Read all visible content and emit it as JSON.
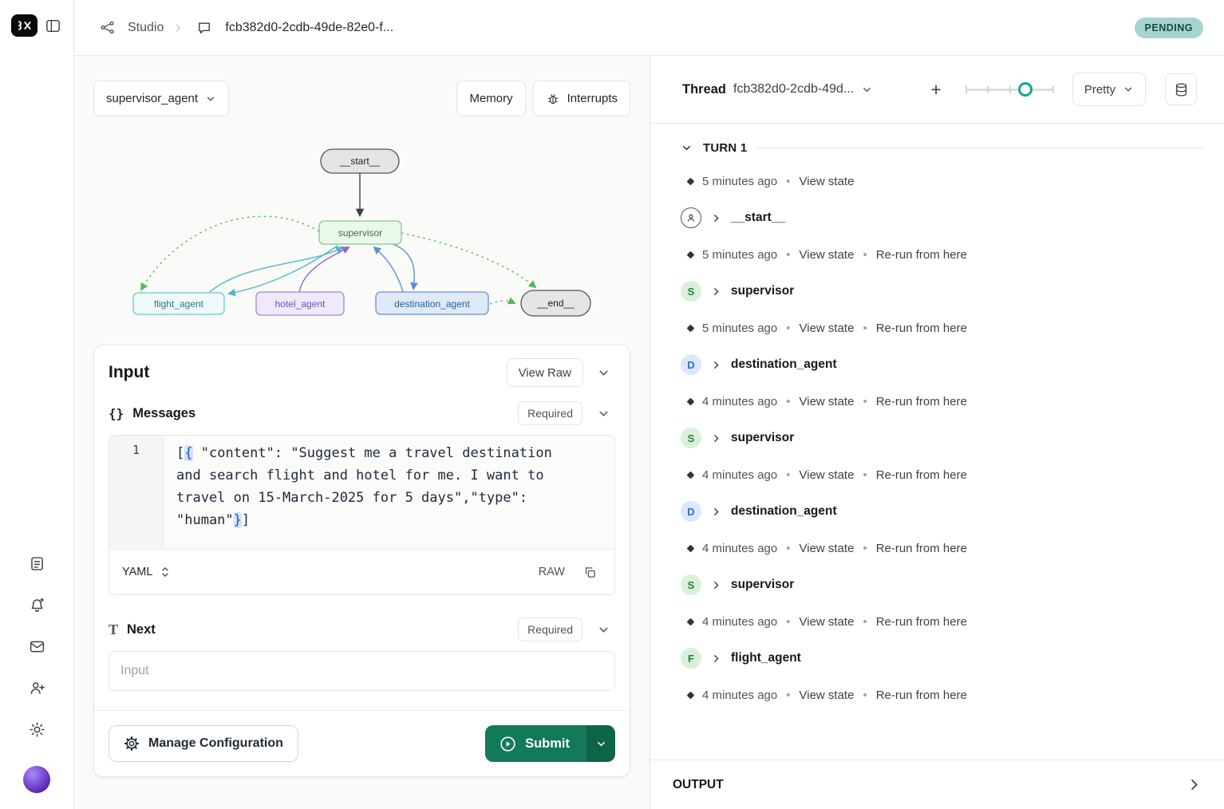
{
  "colors": {
    "accent_green": "#12795a",
    "accent_green_dark": "#0d6447",
    "pending_bg": "#a7d4cf",
    "pending_text": "#1a4742",
    "slider_accent": "#1aa396",
    "badge_green_bg": "#d8f1da",
    "badge_green_text": "#2c8040",
    "badge_blue_bg": "#d9e8fa",
    "badge_blue_text": "#2f6fce"
  },
  "header": {
    "app": "Studio",
    "thread_id": "fcb382d0-2cdb-49de-82e0-f...",
    "status": "PENDING"
  },
  "graph_panel": {
    "agent_selector": "supervisor_agent",
    "memory_button": "Memory",
    "interrupts_button": "Interrupts",
    "nodes": {
      "start": "__start__",
      "supervisor": "supervisor",
      "flight_agent": "flight_agent",
      "hotel_agent": "hotel_agent",
      "destination_agent": "destination_agent",
      "end": "__end__"
    }
  },
  "input_card": {
    "title": "Input",
    "view_raw_button": "View Raw",
    "messages": {
      "icon": "{}",
      "label": "Messages",
      "required_badge": "Required"
    },
    "editor": {
      "line_number": "1",
      "language": "YAML",
      "raw_label": "RAW",
      "segments": [
        {
          "text": "[",
          "cls": "tok"
        },
        {
          "text": "{",
          "cls": "tok-hl"
        },
        {
          "text": " \"content\": \"Suggest me a travel destination and search flight and hotel for me. I want to travel on 15-March-2025 for 5 days\",\"type\": \"human\"",
          "cls": "tok"
        },
        {
          "text": "}",
          "cls": "tok-hl"
        },
        {
          "text": "]",
          "cls": "tok"
        }
      ]
    },
    "next": {
      "icon": "T",
      "label": "Next",
      "required_badge": "Required",
      "placeholder": "Input"
    },
    "manage_config_button": "Manage Configuration",
    "submit_button": "Submit"
  },
  "thread_panel": {
    "thread_label": "Thread",
    "thread_id": "fcb382d0-2cdb-49d...",
    "add_button": "+",
    "view_mode": "Pretty",
    "turn_header": "TURN 1",
    "output_label": "OUTPUT",
    "timeline": [
      {
        "type": "meta",
        "time": "5 minutes ago",
        "actions": [
          "View state"
        ]
      },
      {
        "type": "node",
        "name": "__start__",
        "badge": "person",
        "color": "person"
      },
      {
        "type": "meta",
        "time": "5 minutes ago",
        "actions": [
          "View state",
          "Re-run from here"
        ]
      },
      {
        "type": "node",
        "name": "supervisor",
        "badge": "S",
        "color": "green"
      },
      {
        "type": "meta",
        "time": "5 minutes ago",
        "actions": [
          "View state",
          "Re-run from here"
        ]
      },
      {
        "type": "node",
        "name": "destination_agent",
        "badge": "D",
        "color": "blue"
      },
      {
        "type": "meta",
        "time": "4 minutes ago",
        "actions": [
          "View state",
          "Re-run from here"
        ]
      },
      {
        "type": "node",
        "name": "supervisor",
        "badge": "S",
        "color": "green"
      },
      {
        "type": "meta",
        "time": "4 minutes ago",
        "actions": [
          "View state",
          "Re-run from here"
        ]
      },
      {
        "type": "node",
        "name": "destination_agent",
        "badge": "D",
        "color": "blue"
      },
      {
        "type": "meta",
        "time": "4 minutes ago",
        "actions": [
          "View state",
          "Re-run from here"
        ]
      },
      {
        "type": "node",
        "name": "supervisor",
        "badge": "S",
        "color": "green"
      },
      {
        "type": "meta",
        "time": "4 minutes ago",
        "actions": [
          "View state",
          "Re-run from here"
        ]
      },
      {
        "type": "node",
        "name": "flight_agent",
        "badge": "F",
        "color": "green"
      },
      {
        "type": "meta",
        "time": "4 minutes ago",
        "actions": [
          "View state",
          "Re-run from here"
        ]
      }
    ]
  }
}
